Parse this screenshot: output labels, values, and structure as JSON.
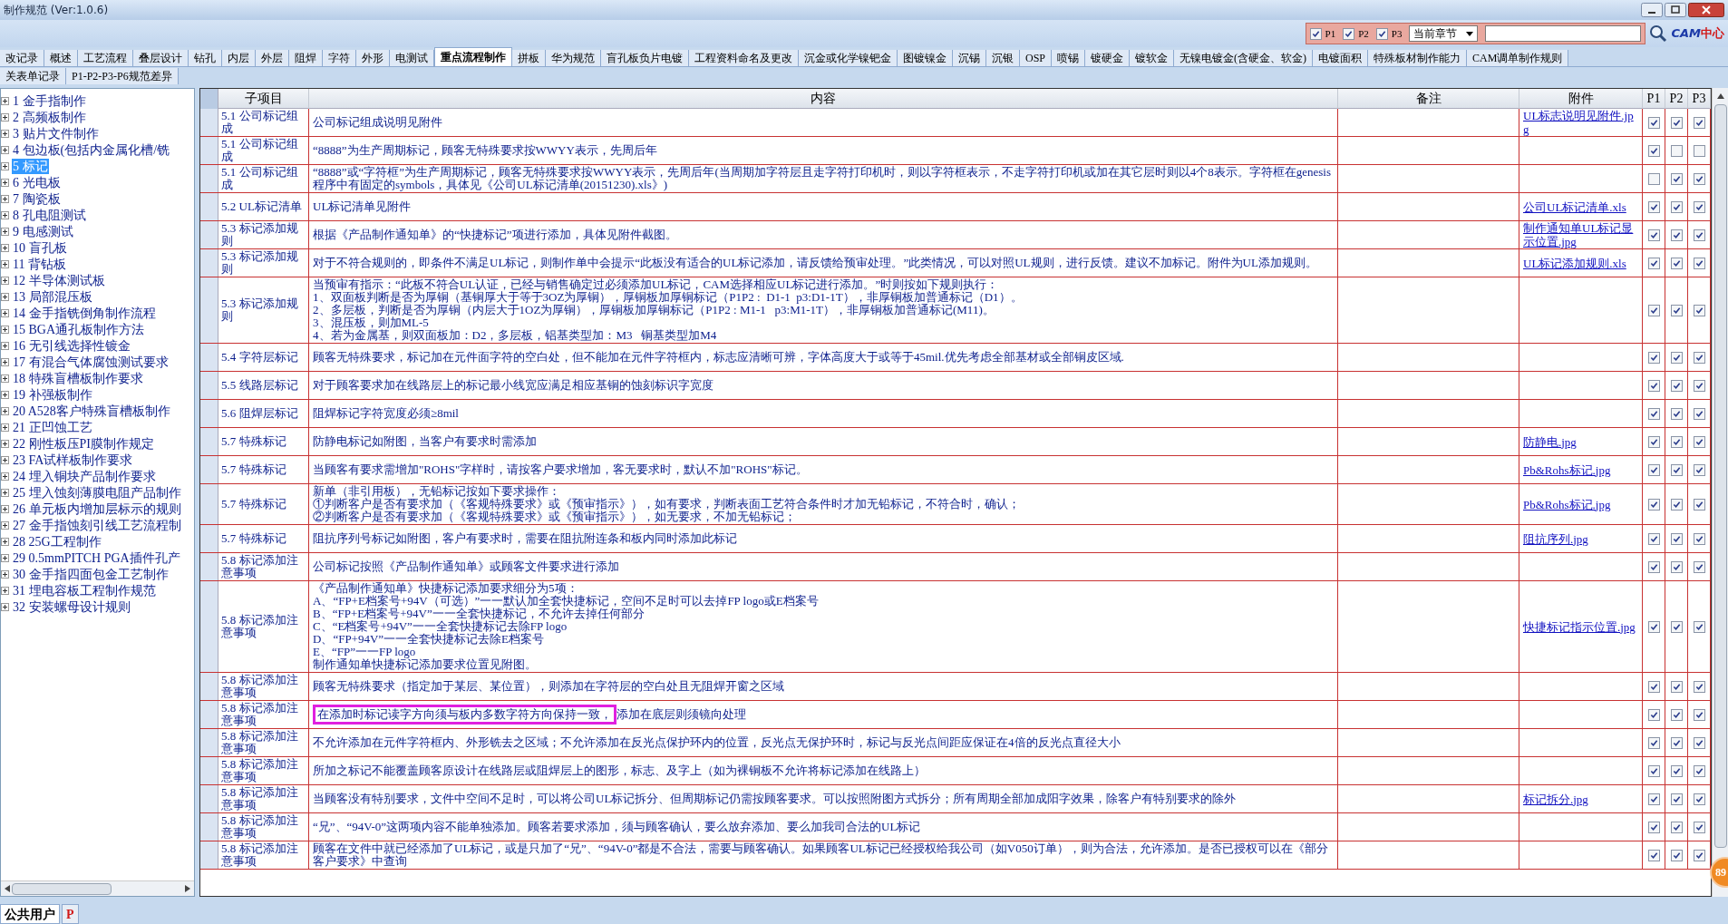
{
  "window": {
    "title": "制作规范 (Ver:1.0.6)"
  },
  "filter": {
    "options": [
      {
        "label": "P1",
        "checked": true
      },
      {
        "label": "P2",
        "checked": true
      },
      {
        "label": "P3",
        "checked": true
      }
    ],
    "scope": "当前章节",
    "logo": {
      "part1": "CAM",
      "part2": "中心"
    }
  },
  "tabs": [
    {
      "label": "改记录",
      "selected": false
    },
    {
      "label": "概述",
      "selected": false
    },
    {
      "label": "工艺流程",
      "selected": false
    },
    {
      "label": "叠层设计",
      "selected": false
    },
    {
      "label": "钻孔",
      "selected": false
    },
    {
      "label": "内层",
      "selected": false
    },
    {
      "label": "外层",
      "selected": false
    },
    {
      "label": "阻焊",
      "selected": false
    },
    {
      "label": "字符",
      "selected": false
    },
    {
      "label": "外形",
      "selected": false
    },
    {
      "label": "电测试",
      "selected": false
    },
    {
      "label": "重点流程制作",
      "selected": true
    },
    {
      "label": "拼板",
      "selected": false
    },
    {
      "label": "华为规范",
      "selected": false
    },
    {
      "label": "盲孔板负片电镀",
      "selected": false
    },
    {
      "label": "工程资料命名及更改",
      "selected": false
    },
    {
      "label": "沉金或化学镍钯金",
      "selected": false
    },
    {
      "label": "图镀镍金",
      "selected": false
    },
    {
      "label": "沉锡",
      "selected": false
    },
    {
      "label": "沉银",
      "selected": false
    },
    {
      "label": "OSP",
      "selected": false
    },
    {
      "label": "喷锡",
      "selected": false
    },
    {
      "label": "镀硬金",
      "selected": false
    },
    {
      "label": "镀软金",
      "selected": false
    },
    {
      "label": "无镍电镀金(含硬金、软金)",
      "selected": false
    },
    {
      "label": "电镀面积",
      "selected": false
    },
    {
      "label": "特殊板材制作能力",
      "selected": false
    },
    {
      "label": "CAM调单制作规则",
      "selected": false
    }
  ],
  "tabs_row_2": [
    {
      "label": "关表单记录",
      "selected": false
    },
    {
      "label": "P1-P2-P3-P6规范差异",
      "selected": false
    }
  ],
  "tree": [
    {
      "label": "1 金手指制作",
      "selected": false
    },
    {
      "label": "2 高频板制作",
      "selected": false
    },
    {
      "label": "3 贴片文件制作",
      "selected": false
    },
    {
      "label": "4 包边板(包括内金属化槽/铣",
      "selected": false
    },
    {
      "label": "5 标记",
      "selected": true
    },
    {
      "label": "6 光电板",
      "selected": false
    },
    {
      "label": "7 陶瓷板",
      "selected": false
    },
    {
      "label": "8 孔电阻测试",
      "selected": false
    },
    {
      "label": "9 电感测试",
      "selected": false
    },
    {
      "label": "10 盲孔板",
      "selected": false
    },
    {
      "label": "11 背钻板",
      "selected": false
    },
    {
      "label": "12 半导体测试板",
      "selected": false
    },
    {
      "label": "13 局部混压板",
      "selected": false
    },
    {
      "label": "14 金手指铣倒角制作流程",
      "selected": false
    },
    {
      "label": "15 BGA通孔板制作方法",
      "selected": false
    },
    {
      "label": "16 无引线选择性镀金",
      "selected": false
    },
    {
      "label": "17 有混合气体腐蚀测试要求",
      "selected": false
    },
    {
      "label": "18 特殊盲槽板制作要求",
      "selected": false
    },
    {
      "label": "19 补强板制作",
      "selected": false
    },
    {
      "label": "20 A528客户特殊盲槽板制作",
      "selected": false
    },
    {
      "label": "21 正凹蚀工艺",
      "selected": false
    },
    {
      "label": "22 刚性板压PI膜制作规定",
      "selected": false
    },
    {
      "label": "23 FA试样板制作要求",
      "selected": false
    },
    {
      "label": "24 埋入铜块产品制作要求",
      "selected": false
    },
    {
      "label": "25 埋入蚀刻薄膜电阻产品制作",
      "selected": false
    },
    {
      "label": "26 单元板内增加层标示的规则",
      "selected": false
    },
    {
      "label": "27 金手指蚀刻引线工艺流程制",
      "selected": false
    },
    {
      "label": "28 25G工程制作",
      "selected": false
    },
    {
      "label": "29 0.5mmPITCH PGA插件孔产",
      "selected": false
    },
    {
      "label": "30 金手指四面包金工艺制作",
      "selected": false
    },
    {
      "label": "31 埋电容板工程制作规范",
      "selected": false
    },
    {
      "label": "32 安装螺母设计规则",
      "selected": false
    }
  ],
  "table": {
    "columns": [
      "子项目",
      "内容",
      "备注",
      "附件",
      "P1",
      "P2",
      "P3"
    ],
    "rows": [
      {
        "item": "5.1 公司标记组成",
        "content": "公司标记组成说明见附件",
        "attachment": "UL标志说明见附件.jpg",
        "p1": true,
        "p2": true,
        "p3": true
      },
      {
        "item": "5.1 公司标记组成",
        "content": "“8888”为生产周期标记，顾客无特殊要求按WWYY表示，先周后年",
        "p1": true,
        "p2": false,
        "p3": false
      },
      {
        "item": "5.1 公司标记组成",
        "content": "“8888”或“字符框”为生产周期标记，顾客无特殊要求按WWYY表示，先周后年(当周期加字符层且走字符打印机时，则以字符框表示，不走字符打印机或加在其它层时则以4个8表示。字符框在genesis 程序中有固定的symbols，具体见《公司UL标记清单(20151230).xls》)",
        "p1": false,
        "p2": true,
        "p3": true
      },
      {
        "item": "5.2 UL标记清单",
        "content": "UL标记清单见附件",
        "attachment": "公司UL标记清单.xls",
        "p1": true,
        "p2": true,
        "p3": true
      },
      {
        "item": "5.3 标记添加规则",
        "content": "根据《产品制作通知单》的“快捷标记”项进行添加，具体见附件截图。",
        "attachment": "制作通知单UL标记显示位置.jpg",
        "p1": true,
        "p2": true,
        "p3": true
      },
      {
        "item": "5.3 标记添加规则",
        "content": "对于不符合规则的，即条件不满足UL标记，则制作单中会提示“此板没有适合的UL标记添加，请反馈给预审处理。”此类情况，可以对照UL规则，进行反馈。建议不加标记。附件为UL添加规则。",
        "attachment": "UL标记添加规则.xls",
        "p1": true,
        "p2": true,
        "p3": true
      },
      {
        "item": "5.3 标记添加规则",
        "content": "当预审有指示：“此板不符合UL认证，已经与销售确定过必须添加UL标记，CAM选择相应UL标记进行添加。”时则按如下规则执行：\n1、双面板判断是否为厚铜（基铜厚大于等于3OZ为厚铜），厚铜板加厚铜标记（P1P2 :  D1-1  p3:D1-1T），非厚铜板加普通标记（D1）。\n2、多层板，判断是否为厚铜（内层大于1OZ为厚铜），厚铜板加厚铜标记（P1P2 : M1-1   p3:M1-1T），非厚铜板加普通标记(M11)。\n3、混压板，则加ML-5\n4、若为金属基，则双面板加：D2，多层板，铝基类型加：M3   铜基类型加M4",
        "p1": true,
        "p2": true,
        "p3": true
      },
      {
        "item": "5.4 字符层标记",
        "content": "顾客无特殊要求，标记加在元件面字符的空白处，但不能加在元件字符框内，标志应清晰可辨，字体高度大于或等于45mil.优先考虑全部基材或全部铜皮区域.",
        "p1": true,
        "p2": true,
        "p3": true
      },
      {
        "item": "5.5 线路层标记",
        "content": "对于顾客要求加在线路层上的标记最小线宽应满足相应基铜的蚀刻标识字宽度",
        "p1": true,
        "p2": true,
        "p3": true
      },
      {
        "item": "5.6 阻焊层标记",
        "content": "阻焊标记字符宽度必须≥8mil",
        "p1": true,
        "p2": true,
        "p3": true
      },
      {
        "item": "5.7 特殊标记",
        "content": "防静电标记如附图，当客户有要求时需添加",
        "attachment": "防静电.jpg",
        "p1": true,
        "p2": true,
        "p3": true
      },
      {
        "item": "5.7 特殊标记",
        "content": "当顾客有要求需增加\"ROHS\"字样时，请按客户要求增加，客无要求时，默认不加\"ROHS\"标记。",
        "attachment": "Pb&Rohs标记.jpg",
        "p1": true,
        "p2": true,
        "p3": true
      },
      {
        "item": "5.7 特殊标记",
        "content": "新单（非引用板），无铅标记按如下要求操作：\n①判断客户是否有要求加（《客规特殊要求》或《预审指示》），如有要求，判断表面工艺符合条件时才加无铅标记，不符合时，确认；\n②判断客户是否有要求加（《客规特殊要求》或《预审指示》），如无要求，不加无铅标记；",
        "attachment": "Pb&Rohs标记.jpg",
        "p1": true,
        "p2": true,
        "p3": true
      },
      {
        "item": "5.7 特殊标记",
        "content": "阻抗序列号标记如附图，客户有要求时，需要在阻抗附连条和板内同时添加此标记",
        "attachment": "阻抗序列.jpg",
        "p1": true,
        "p2": true,
        "p3": true
      },
      {
        "item": "5.8 标记添加注意事项",
        "content": "公司标记按照《产品制作通知单》或顾客文件要求进行添加",
        "p1": true,
        "p2": true,
        "p3": true
      },
      {
        "item": "5.8 标记添加注意事项",
        "content": "《产品制作通知单》快捷标记添加要求细分为5项：\nA、“FP+E档案号+94V（可选）”一一默认加全套快捷标记，空间不足时可以去掉FP logo或E档案号\nB、“FP+E档案号+94V”一一全套快捷标记，不允许去掉任何部分\nC、“E档案号+94V”一一全套快捷标记去除FP logo\nD、“FP+94V”一一全套快捷标记去除E档案号\nE、“FP”一一FP logo\n制作通知单快捷标记添加要求位置见附图。",
        "attachment": "快捷标记指示位置.jpg",
        "p1": true,
        "p2": true,
        "p3": true
      },
      {
        "item": "5.8 标记添加注意事项",
        "content": "顾客无特殊要求（指定加于某层、某位置），则添加在字符层的空白处且无阻焊开窗之区域",
        "p1": true,
        "p2": true,
        "p3": true
      },
      {
        "item": "5.8 标记添加注意事项",
        "callout": "在添加时标记读字方向须与板内多数字符方向保持一致，",
        "content": "添加在底层则须镜向处理",
        "p1": true,
        "p2": true,
        "p3": true
      },
      {
        "item": "5.8 标记添加注意事项",
        "content": "不允许添加在元件字符框内、外形铣去之区域；不允许添加在反光点保护环内的位置，反光点无保护环时，标记与反光点间距应保证在4倍的反光点直径大小",
        "p1": true,
        "p2": true,
        "p3": true
      },
      {
        "item": "5.8 标记添加注意事项",
        "content": "所加之标记不能覆盖顾客原设计在线路层或阻焊层上的图形，标志、及字上（如为裸铜板不允许将标记添加在线路上）",
        "p1": true,
        "p2": true,
        "p3": true
      },
      {
        "item": "5.8 标记添加注意事项",
        "content": "当顾客没有特别要求，文件中空间不足时，可以将公司UL标记拆分、但周期标记仍需按顾客要求。可以按照附图方式拆分；所有周期全部加成阳字效果，除客户有特别要求的除外",
        "attachment": "标记拆分.jpg",
        "p1": true,
        "p2": true,
        "p3": true
      },
      {
        "item": "5.8 标记添加注意事项",
        "content": "“兄”、“94V-0”这两项内容不能单独添加。顾客若要求添加，须与顾客确认，要么放弃添加、要么加我司合法的UL标记",
        "p1": true,
        "p2": true,
        "p3": true
      },
      {
        "item": "5.8 标记添加注意事项",
        "content": "顾客在文件中就已经添加了UL标记，或是只加了“兄”、“94V-0”都是不合法，需要与顾客确认。如果顾客UL标记已经授权给我公司（如V050订单），则为合法，允许添加。是否已授权可以在《部分客户要求》中查询",
        "p1": true,
        "p2": true,
        "p3": true
      }
    ]
  },
  "badge": "89",
  "bottom_tabs": [
    {
      "label": "公共用户",
      "selected": true
    },
    {
      "label": "P",
      "selected": false
    }
  ]
}
